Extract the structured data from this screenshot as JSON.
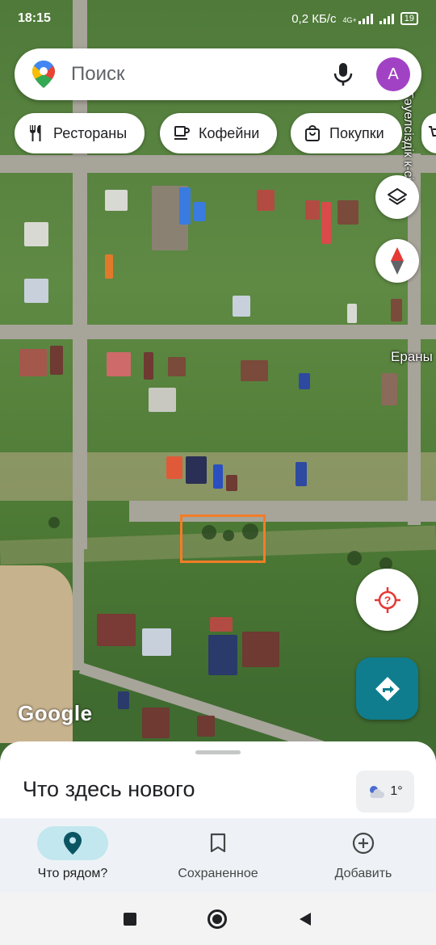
{
  "status_bar": {
    "time": "18:15",
    "speed": "0,2 КБ/с",
    "network": "4G+",
    "battery": "19"
  },
  "search": {
    "placeholder": "Поиск",
    "avatar_letter": "A"
  },
  "chips": [
    {
      "label": "Рестораны",
      "icon": "fork-knife-icon"
    },
    {
      "label": "Кофейни",
      "icon": "coffee-cup-icon"
    },
    {
      "label": "Покупки",
      "icon": "shopping-bag-icon"
    }
  ],
  "map": {
    "street_label_vertical": "Тәуелсіздік к-сі",
    "street_label_right": "Ераны",
    "logo": "Google",
    "selection_color": "#f27d27"
  },
  "sheet": {
    "title": "Что здесь нового",
    "weather_temp": "1°"
  },
  "bottom_nav": [
    {
      "label": "Что рядом?",
      "icon": "location-pin-icon",
      "active": true
    },
    {
      "label": "Сохраненное",
      "icon": "bookmark-icon",
      "active": false
    },
    {
      "label": "Добавить",
      "icon": "add-circle-icon",
      "active": false
    }
  ],
  "colors": {
    "accent": "#0f7d8e",
    "avatar": "#a142c4",
    "active_nav_bg": "#c2e7ee"
  }
}
